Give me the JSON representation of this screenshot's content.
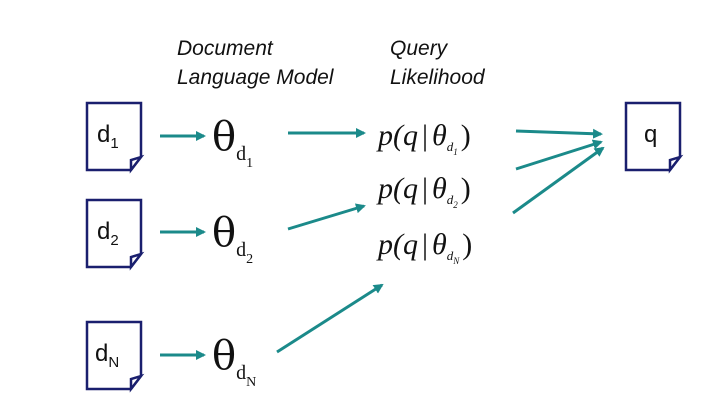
{
  "headers": {
    "doc_lm_line1": "Document",
    "doc_lm_line2": "Language Model",
    "ql_line1": "Query",
    "ql_line2": "Likelihood"
  },
  "documents": [
    {
      "letter": "d",
      "sub": "1"
    },
    {
      "letter": "d",
      "sub": "2"
    },
    {
      "letter": "d",
      "sub": "N"
    }
  ],
  "models": [
    {
      "symbol": "θ",
      "base": "d",
      "sub": "1"
    },
    {
      "symbol": "θ",
      "base": "d",
      "sub": "2"
    },
    {
      "symbol": "θ",
      "base": "d",
      "sub": "N"
    }
  ],
  "likelihoods": [
    {
      "open": "p(",
      "q": "q",
      "bar": "|",
      "theta": "θ",
      "base": "d",
      "sub": "1",
      "close": ")"
    },
    {
      "open": "p(",
      "q": "q",
      "bar": "|",
      "theta": "θ",
      "base": "d",
      "sub": "2",
      "close": ")"
    },
    {
      "open": "p(",
      "q": "q",
      "bar": "|",
      "theta": "θ",
      "base": "d",
      "sub": "N",
      "close": ")"
    }
  ],
  "query": {
    "label": "q"
  },
  "colors": {
    "arrow": "#1b8a8a",
    "doc_border": "#1a1f6e"
  }
}
